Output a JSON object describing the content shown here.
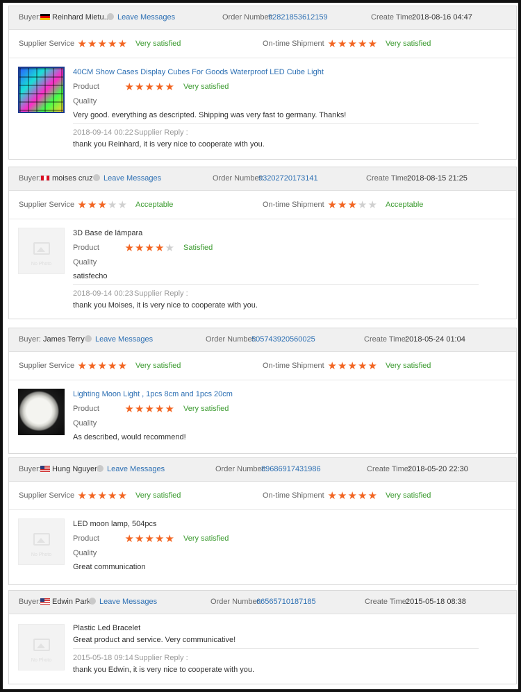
{
  "labels": {
    "buyer": "Buyer:",
    "leave_messages": "Leave Messages",
    "order_number": "Order Number:",
    "create_time": "Create Time:",
    "supplier_service": "Supplier Service",
    "ontime_shipment": "On-time Shipment",
    "product": "Product",
    "quality": "Quality",
    "supplier_reply": "Supplier Reply :",
    "no_photo": "No Photo"
  },
  "colors": {
    "star": "#f26522",
    "star_off": "#d0d0d0",
    "satisfaction": "#3a9a2e",
    "link": "#2c6fb3"
  },
  "reviews": [
    {
      "buyer": "Reinhard Mietu...",
      "flag": "germany-flag",
      "order_number": "92821853612159",
      "create_time": "2018-08-16 04:47",
      "supplier_service": {
        "stars": 5,
        "text": "Very satisfied"
      },
      "shipment": {
        "stars": 5,
        "text": "Very satisfied"
      },
      "product_title": "40CM Show Cases Display Cubes For Goods Waterproof LED Cube Light",
      "product": {
        "stars": 5,
        "text": "Very satisfied"
      },
      "comment": "Very good. everything as descripted. Shipping was very fast to germany. Thanks!",
      "reply_time": "2018-09-14 00:22",
      "reply": "thank you Reinhard, it is very nice to cooperate with you."
    },
    {
      "buyer": "moises cruz",
      "flag": "peru-flag",
      "order_number": "93202720173141",
      "create_time": "2018-08-15 21:25",
      "supplier_service": {
        "stars": 3,
        "text": "Acceptable"
      },
      "shipment": {
        "stars": 3,
        "text": "Acceptable"
      },
      "product_title": "3D Base de lámpara",
      "product": {
        "stars": 4,
        "text": "Satisfied"
      },
      "comment": "satisfecho",
      "reply_time": "2018-09-14 00:23",
      "reply": "thank you Moises, it is very nice to cooperate with you."
    },
    {
      "buyer": "James Terry",
      "order_number": "505743920560025",
      "create_time": "2018-05-24 01:04",
      "supplier_service": {
        "stars": 5,
        "text": "Very satisfied"
      },
      "shipment": {
        "stars": 5,
        "text": "Very satisfied"
      },
      "product_title": "Lighting Moon Light , 1pcs 8cm and 1pcs 20cm",
      "product": {
        "stars": 5,
        "text": "Very satisfied"
      },
      "comment": "As described, would recommend!"
    },
    {
      "buyer": "Hung Nguyen",
      "flag": "usa-flag",
      "order_number": "89686917431986",
      "create_time": "2018-05-20 22:30",
      "supplier_service": {
        "stars": 5,
        "text": "Very satisfied"
      },
      "shipment": {
        "stars": 5,
        "text": "Very satisfied"
      },
      "product_title": "LED moon lamp, 504pcs",
      "product": {
        "stars": 5,
        "text": "Very satisfied"
      },
      "comment": "Great communication"
    },
    {
      "buyer": "Edwin Park",
      "flag": "usa-flag",
      "order_number": "66565710187185",
      "create_time": "2015-05-18 08:38",
      "product_title": "Plastic Led Bracelet",
      "comment": "Great product and service. Very communicative!",
      "reply_time": "2015-05-18 09:14",
      "reply": "thank you Edwin, it is very nice to cooperate with you."
    }
  ]
}
